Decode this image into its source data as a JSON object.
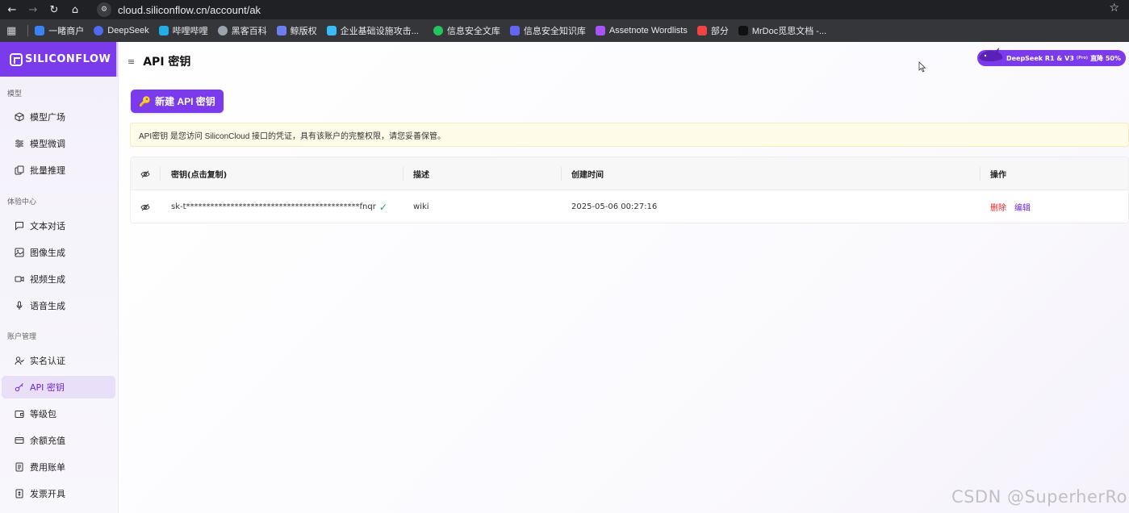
{
  "browser": {
    "url": "cloud.siliconflow.cn/account/ak",
    "bookmarks": [
      {
        "label": "一睹商户",
        "color": "#3b82f6"
      },
      {
        "label": "DeepSeek",
        "color": "#4f6bf0"
      },
      {
        "label": "哔哩哔哩",
        "color": "#23ade5"
      },
      {
        "label": "黑客百科",
        "color": "#9ca3af"
      },
      {
        "label": "鲸版权",
        "color": "#6b7ff0"
      },
      {
        "label": "企业基础设施攻击...",
        "color": "#38bdf8"
      },
      {
        "label": "信息安全文库",
        "color": "#22c55e"
      },
      {
        "label": "信息安全知识库",
        "color": "#6366f1"
      },
      {
        "label": "Assetnote Wordlists",
        "color": "#a855f7"
      },
      {
        "label": "部分",
        "color": "#ef4444"
      },
      {
        "label": "MrDoc觅思文档 -...",
        "color": "#111111"
      }
    ]
  },
  "sidebar": {
    "logo": "SILICONFLOW",
    "sections": [
      {
        "title": "模型",
        "items": [
          {
            "label": "模型广场",
            "icon": "cube-icon"
          },
          {
            "label": "模型微调",
            "icon": "sliders-icon"
          },
          {
            "label": "批量推理",
            "icon": "copy-icon"
          }
        ]
      },
      {
        "title": "体验中心",
        "items": [
          {
            "label": "文本对话",
            "icon": "chat-icon"
          },
          {
            "label": "图像生成",
            "icon": "image-icon"
          },
          {
            "label": "视频生成",
            "icon": "video-icon"
          },
          {
            "label": "语音生成",
            "icon": "mic-icon"
          }
        ]
      },
      {
        "title": "账户管理",
        "items": [
          {
            "label": "实名认证",
            "icon": "user-check-icon"
          },
          {
            "label": "API 密钥",
            "icon": "key-icon",
            "active": true
          },
          {
            "label": "等级包",
            "icon": "wallet-icon"
          },
          {
            "label": "余额充值",
            "icon": "card-icon"
          },
          {
            "label": "费用账单",
            "icon": "bill-icon"
          },
          {
            "label": "发票开具",
            "icon": "invoice-icon"
          }
        ]
      }
    ]
  },
  "header": {
    "title": "API 密钥",
    "promo": "DeepSeek R1 & V3",
    "promo_tag": "(Pro)",
    "promo_discount": "直降 50%"
  },
  "main": {
    "new_button": "新建 API 密钥",
    "notice": "API密钥 是您访问 SiliconCloud 接口的凭证，具有该账户的完整权限，请您妥善保管。",
    "table": {
      "columns": [
        "密钥(点击复制)",
        "描述",
        "创建时间",
        "操作"
      ],
      "rows": [
        {
          "key": "sk-t*******************************************fnqr",
          "description": "wiki",
          "created": "2025-05-06 00:27:16",
          "actions": [
            "删除",
            "编辑"
          ]
        }
      ]
    }
  },
  "watermark": "CSDN @SuperherRo",
  "colors": {
    "accent": "#7c3aed",
    "danger": "#dc2626",
    "success": "#22a35a"
  }
}
